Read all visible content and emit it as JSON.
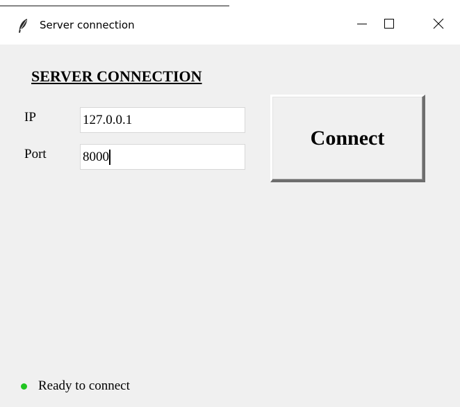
{
  "window": {
    "title": "Server connection",
    "app_icon": "feather-icon",
    "controls": {
      "minimize": "minimize-icon",
      "maximize": "maximize-icon",
      "close": "close-icon"
    }
  },
  "form": {
    "heading": "SERVER CONNECTION",
    "ip_label": "IP",
    "ip_value": "127.0.0.1",
    "port_label": "Port",
    "port_value": "8000",
    "connect_label": "Connect"
  },
  "status": {
    "text": "Ready to connect",
    "color": "#21c521"
  }
}
